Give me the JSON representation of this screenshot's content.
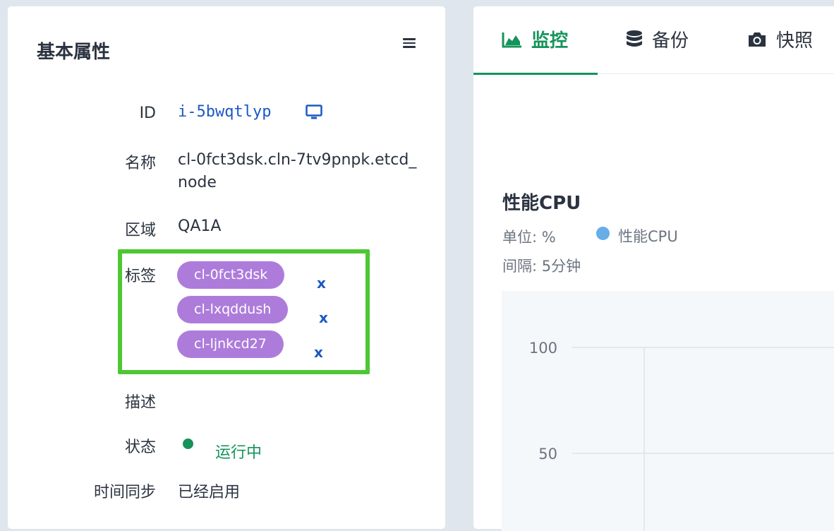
{
  "panel": {
    "title": "基本属性",
    "fields": {
      "id_label": "ID",
      "id_value": "i-5bwqtlyp",
      "name_label": "名称",
      "name_value": "cl-0fct3dsk.cln-7tv9pnpk.etcd_node",
      "zone_label": "区域",
      "zone_value": "QA1A",
      "tags_label": "标签",
      "desc_label": "描述",
      "status_label": "状态",
      "status_value": "运行中",
      "timesync_label": "时间同步",
      "timesync_value": "已经启用"
    },
    "tags": [
      "cl-0fct3dsk",
      "cl-lxqddush",
      "cl-ljnkcd27"
    ],
    "tag_remove_glyph": "x",
    "status_color": "#16935b",
    "tag_color": "#ad7cdb",
    "highlight_color": "#4ec735"
  },
  "tabs": [
    {
      "label": "监控",
      "icon": "area-chart-icon",
      "active": true
    },
    {
      "label": "备份",
      "icon": "database-icon",
      "active": false
    },
    {
      "label": "快照",
      "icon": "camera-icon",
      "active": false
    }
  ],
  "chart": {
    "unit": "单位: %",
    "interval": "间隔: 5分钟",
    "legend_color": "#67ade8"
  },
  "chart_data": {
    "type": "line",
    "title": "性能CPU",
    "series": [
      {
        "name": "性能CPU",
        "values": []
      }
    ],
    "y_ticks": [
      "100",
      "50"
    ],
    "grid": true
  }
}
